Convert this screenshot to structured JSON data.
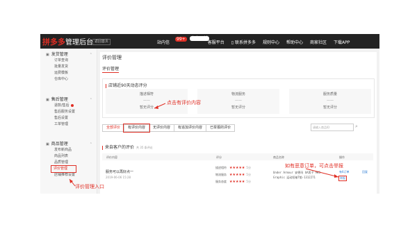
{
  "topbar": {
    "logo": "拼多多",
    "logo_sub": "管理后台",
    "back_label": "返回首页",
    "nav": [
      "站内信",
      "客服平台",
      "联系拼多多",
      "规则中心",
      "帮助中心",
      "商家社区",
      "下载APP"
    ],
    "badge_new": "99+",
    "badge_tip": "内容更新"
  },
  "sidebar": {
    "sections": [
      {
        "title": "发货管理",
        "items": [
          "订单查询",
          "批量发货",
          "运费模板",
          "仓库中心"
        ]
      },
      {
        "title": "售后管理",
        "items": [
          "退款/售后",
          "售后服务设置",
          "售后设置",
          "工单管理"
        ]
      },
      {
        "title": "商品管理",
        "items": [
          "发布新商品",
          "商品列表",
          "品质管理",
          "评价管理",
          "店铺推荐设置"
        ]
      }
    ]
  },
  "main": {
    "page_title": "评价管理",
    "tab": "评价管理",
    "card_title": "店铺近90天动态评分",
    "metrics": [
      {
        "name": "描述相符",
        "dash": "——",
        "value": "暂无评分"
      },
      {
        "name": "物流服务",
        "dash": "——",
        "value": "暂无评分"
      },
      {
        "name": "服务质量",
        "dash": "——",
        "value": "暂无评分"
      }
    ],
    "filters": [
      "全部评价",
      "有评价内容",
      "无评价内容",
      "有追加评价内容",
      "已举报的评价"
    ],
    "search_placeholder": "请输入商品ID",
    "list_title": "来自客户的评价",
    "list_count": "共 35 条评论",
    "columns": [
      "评价内容",
      "评分",
      "商品名称",
      "操作"
    ],
    "row": {
      "comment": "服务可以再好点一",
      "time": "2019-06-06 15:28",
      "ratings": [
        {
          "label": "描述相符",
          "score": "5分"
        },
        {
          "label": "物流服务",
          "score": "5分"
        },
        {
          "label": "服务态度",
          "score": "5分"
        }
      ],
      "product": "Under Armour 安德玛 UA男子 MK1 Graphic 运动短袖T恤-1312271",
      "op_flag": "有6订单",
      "op_reply": "回复",
      "op_report": "举报"
    }
  },
  "annotations": {
    "click_content": "点击有评价内容",
    "report_tip": "如有恶意订单，可点击举报",
    "entry": "评价管理入口"
  },
  "colors": {
    "brand": "#e02e24",
    "topbar": "#232323",
    "link": "#2b7bd3"
  }
}
